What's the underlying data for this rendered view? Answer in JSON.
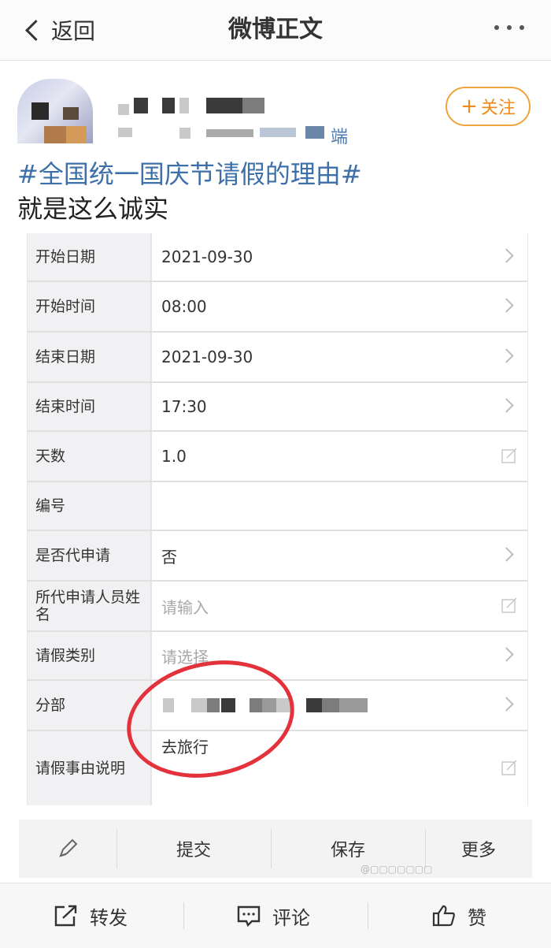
{
  "header": {
    "back_label": "返回",
    "title": "微博正文",
    "more_icon": "more-dots-icon"
  },
  "post": {
    "follow_label": "关注",
    "source": "端",
    "hashtag": "#全国统一国庆节请假的理由#",
    "text": "就是这么诚实"
  },
  "form": {
    "rows": [
      {
        "label": "开始日期",
        "value": "2021-09-30",
        "control": "arrow"
      },
      {
        "label": "开始时间",
        "value": "08:00",
        "control": "arrow"
      },
      {
        "label": "结束日期",
        "value": "2021-09-30",
        "control": "arrow"
      },
      {
        "label": "结束时间",
        "value": "17:30",
        "control": "arrow"
      },
      {
        "label": "天数",
        "value": "1.0",
        "control": "edit"
      },
      {
        "label": "编号",
        "value": "",
        "control": "none"
      },
      {
        "label": "是否代申请",
        "value": "否",
        "control": "arrow"
      },
      {
        "label": "所代申请人员姓名",
        "placeholder": "请输入",
        "control": "edit"
      },
      {
        "label": "请假类别",
        "placeholder": "请选择",
        "control": "arrow"
      },
      {
        "label": "分部",
        "value": "",
        "control": "arrow"
      },
      {
        "label": "请假事由说明",
        "value": "去旅行",
        "control": "edit"
      }
    ]
  },
  "actions": {
    "submit": "提交",
    "save": "保存",
    "more": "更多"
  },
  "bottom_bar": {
    "repost": "转发",
    "comment": "评论",
    "like": "赞"
  },
  "colors": {
    "accent_orange": "#f08a18",
    "link_blue": "#3d6fa8",
    "highlight_red": "#e4323c"
  }
}
